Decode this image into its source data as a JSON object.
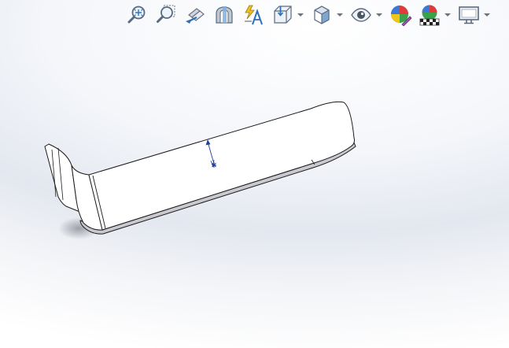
{
  "app": "3D CAD viewport",
  "toolbar": {
    "items": [
      {
        "icon": "zoom-to-fit-icon",
        "has_dropdown": false
      },
      {
        "icon": "zoom-to-area-icon",
        "has_dropdown": false
      },
      {
        "icon": "previous-view-icon",
        "has_dropdown": false
      },
      {
        "icon": "section-view-icon",
        "has_dropdown": false
      },
      {
        "icon": "dynamic-annotation-views-icon",
        "has_dropdown": false
      },
      {
        "icon": "view-orientation-icon",
        "has_dropdown": true
      },
      {
        "icon": "display-style-icon",
        "has_dropdown": true
      },
      {
        "icon": "hide-show-items-icon",
        "has_dropdown": true
      },
      {
        "icon": "edit-appearance-icon",
        "has_dropdown": false
      },
      {
        "icon": "apply-scene-icon",
        "has_dropdown": true
      },
      {
        "icon": "view-settings-icon",
        "has_dropdown": true
      }
    ]
  },
  "model": {
    "name": "sheet-metal-bracket",
    "face_color": "#ffffff",
    "edge_color": "#1a1a1a",
    "thickness_color": "#c9c8d0",
    "direction_arrow_color": "#1f3f9e"
  },
  "colors": {
    "background_top": "#ffffff",
    "background_mid": "#e3e7ef",
    "icon_blue": "#2f6fb8",
    "icon_gray": "#6b7480"
  }
}
